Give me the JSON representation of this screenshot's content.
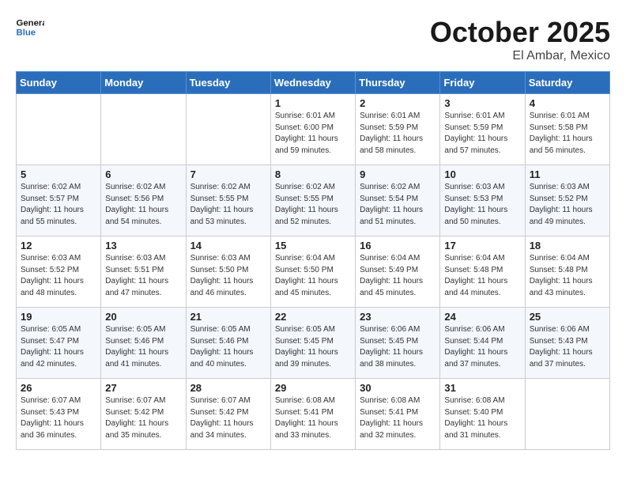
{
  "header": {
    "logo_line1": "General",
    "logo_line2": "Blue",
    "month": "October 2025",
    "location": "El Ambar, Mexico"
  },
  "weekdays": [
    "Sunday",
    "Monday",
    "Tuesday",
    "Wednesday",
    "Thursday",
    "Friday",
    "Saturday"
  ],
  "weeks": [
    [
      {
        "day": "",
        "info": ""
      },
      {
        "day": "",
        "info": ""
      },
      {
        "day": "",
        "info": ""
      },
      {
        "day": "1",
        "info": "Sunrise: 6:01 AM\nSunset: 6:00 PM\nDaylight: 11 hours\nand 59 minutes."
      },
      {
        "day": "2",
        "info": "Sunrise: 6:01 AM\nSunset: 5:59 PM\nDaylight: 11 hours\nand 58 minutes."
      },
      {
        "day": "3",
        "info": "Sunrise: 6:01 AM\nSunset: 5:59 PM\nDaylight: 11 hours\nand 57 minutes."
      },
      {
        "day": "4",
        "info": "Sunrise: 6:01 AM\nSunset: 5:58 PM\nDaylight: 11 hours\nand 56 minutes."
      }
    ],
    [
      {
        "day": "5",
        "info": "Sunrise: 6:02 AM\nSunset: 5:57 PM\nDaylight: 11 hours\nand 55 minutes."
      },
      {
        "day": "6",
        "info": "Sunrise: 6:02 AM\nSunset: 5:56 PM\nDaylight: 11 hours\nand 54 minutes."
      },
      {
        "day": "7",
        "info": "Sunrise: 6:02 AM\nSunset: 5:55 PM\nDaylight: 11 hours\nand 53 minutes."
      },
      {
        "day": "8",
        "info": "Sunrise: 6:02 AM\nSunset: 5:55 PM\nDaylight: 11 hours\nand 52 minutes."
      },
      {
        "day": "9",
        "info": "Sunrise: 6:02 AM\nSunset: 5:54 PM\nDaylight: 11 hours\nand 51 minutes."
      },
      {
        "day": "10",
        "info": "Sunrise: 6:03 AM\nSunset: 5:53 PM\nDaylight: 11 hours\nand 50 minutes."
      },
      {
        "day": "11",
        "info": "Sunrise: 6:03 AM\nSunset: 5:52 PM\nDaylight: 11 hours\nand 49 minutes."
      }
    ],
    [
      {
        "day": "12",
        "info": "Sunrise: 6:03 AM\nSunset: 5:52 PM\nDaylight: 11 hours\nand 48 minutes."
      },
      {
        "day": "13",
        "info": "Sunrise: 6:03 AM\nSunset: 5:51 PM\nDaylight: 11 hours\nand 47 minutes."
      },
      {
        "day": "14",
        "info": "Sunrise: 6:03 AM\nSunset: 5:50 PM\nDaylight: 11 hours\nand 46 minutes."
      },
      {
        "day": "15",
        "info": "Sunrise: 6:04 AM\nSunset: 5:50 PM\nDaylight: 11 hours\nand 45 minutes."
      },
      {
        "day": "16",
        "info": "Sunrise: 6:04 AM\nSunset: 5:49 PM\nDaylight: 11 hours\nand 45 minutes."
      },
      {
        "day": "17",
        "info": "Sunrise: 6:04 AM\nSunset: 5:48 PM\nDaylight: 11 hours\nand 44 minutes."
      },
      {
        "day": "18",
        "info": "Sunrise: 6:04 AM\nSunset: 5:48 PM\nDaylight: 11 hours\nand 43 minutes."
      }
    ],
    [
      {
        "day": "19",
        "info": "Sunrise: 6:05 AM\nSunset: 5:47 PM\nDaylight: 11 hours\nand 42 minutes."
      },
      {
        "day": "20",
        "info": "Sunrise: 6:05 AM\nSunset: 5:46 PM\nDaylight: 11 hours\nand 41 minutes."
      },
      {
        "day": "21",
        "info": "Sunrise: 6:05 AM\nSunset: 5:46 PM\nDaylight: 11 hours\nand 40 minutes."
      },
      {
        "day": "22",
        "info": "Sunrise: 6:05 AM\nSunset: 5:45 PM\nDaylight: 11 hours\nand 39 minutes."
      },
      {
        "day": "23",
        "info": "Sunrise: 6:06 AM\nSunset: 5:45 PM\nDaylight: 11 hours\nand 38 minutes."
      },
      {
        "day": "24",
        "info": "Sunrise: 6:06 AM\nSunset: 5:44 PM\nDaylight: 11 hours\nand 37 minutes."
      },
      {
        "day": "25",
        "info": "Sunrise: 6:06 AM\nSunset: 5:43 PM\nDaylight: 11 hours\nand 37 minutes."
      }
    ],
    [
      {
        "day": "26",
        "info": "Sunrise: 6:07 AM\nSunset: 5:43 PM\nDaylight: 11 hours\nand 36 minutes."
      },
      {
        "day": "27",
        "info": "Sunrise: 6:07 AM\nSunset: 5:42 PM\nDaylight: 11 hours\nand 35 minutes."
      },
      {
        "day": "28",
        "info": "Sunrise: 6:07 AM\nSunset: 5:42 PM\nDaylight: 11 hours\nand 34 minutes."
      },
      {
        "day": "29",
        "info": "Sunrise: 6:08 AM\nSunset: 5:41 PM\nDaylight: 11 hours\nand 33 minutes."
      },
      {
        "day": "30",
        "info": "Sunrise: 6:08 AM\nSunset: 5:41 PM\nDaylight: 11 hours\nand 32 minutes."
      },
      {
        "day": "31",
        "info": "Sunrise: 6:08 AM\nSunset: 5:40 PM\nDaylight: 11 hours\nand 31 minutes."
      },
      {
        "day": "",
        "info": ""
      }
    ]
  ]
}
